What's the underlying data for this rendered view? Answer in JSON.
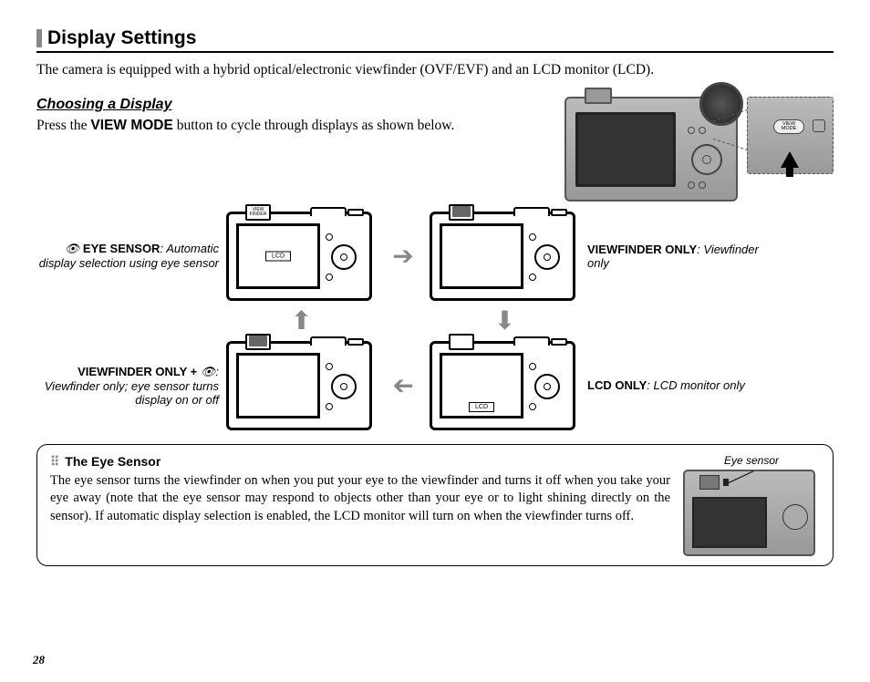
{
  "page_number": "28",
  "section_title": "Display Settings",
  "intro": "The camera is equipped with a hybrid optical/electronic viewfinder (OVF/EVF) and an LCD monitor (LCD).",
  "subheading": "Choosing a Display",
  "sub_text_pre": "Press the ",
  "sub_text_bold": "VIEW MODE",
  "sub_text_post": " button to cycle through displays as shown below.",
  "closeup_button": "VIEW MODE",
  "modes": {
    "eye_sensor": {
      "bold": "EYE SENSOR",
      "rest": ": Automatic display selection using eye sensor"
    },
    "vf_only": {
      "bold": "VIEWFINDER ONLY",
      "rest": ": Viewfinder only"
    },
    "lcd_only": {
      "bold": "LCD ONLY",
      "rest": ": LCD monitor only"
    },
    "vf_plus": {
      "bold": "VIEWFINDER ONLY + ",
      "rest": ": Viewfinder only; eye sensor turns display on or off"
    }
  },
  "tags": {
    "vf": "VIEW FINDER",
    "lcd": "LCD"
  },
  "note": {
    "title": "The Eye Sensor",
    "body": "The eye sensor turns the viewfinder on when you put your eye to the viewfinder and turns it off when you take your eye away (note that the eye sensor may respond to objects other than your eye or to light shining directly on the sensor).  If automatic display selection is enabled, the LCD monitor will turn on when the viewfinder turns off.",
    "caption": "Eye sensor"
  }
}
